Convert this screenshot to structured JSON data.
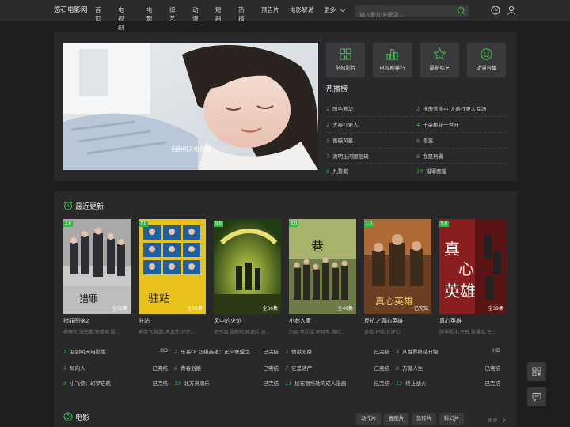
{
  "site": {
    "logo": "悠石电影网"
  },
  "nav": {
    "items": [
      "首页",
      "电视剧",
      "电影",
      "综艺",
      "动漫",
      "短剧",
      "热播",
      "预告片",
      "电影解说",
      "更多"
    ]
  },
  "search": {
    "placeholder": "输入影片关键词..."
  },
  "hero": {
    "caption": "回到明天电影版"
  },
  "quick": [
    {
      "label": "全部影片",
      "icon": "grid-icon"
    },
    {
      "label": "电视剧排行",
      "icon": "bar-chart-icon"
    },
    {
      "label": "最新综艺",
      "icon": "star-icon"
    },
    {
      "label": "动漫合集",
      "icon": "smile-icon"
    }
  ],
  "hot": {
    "title": "热播榜",
    "items": [
      {
        "num": "1",
        "name": "国色芳华"
      },
      {
        "num": "2",
        "name": "推市营业中 大奉打更人专场"
      },
      {
        "num": "3",
        "name": "大奉打更人"
      },
      {
        "num": "4",
        "name": "千朵桃花一世开"
      },
      {
        "num": "5",
        "name": "蔷薇风暴"
      },
      {
        "num": "6",
        "name": "冬至"
      },
      {
        "num": "7",
        "name": "清明上河图密码"
      },
      {
        "num": "8",
        "name": "我是刑警"
      },
      {
        "num": "9",
        "name": "九重紫"
      },
      {
        "num": "10",
        "name": "猎罪图鉴"
      }
    ]
  },
  "recent": {
    "title": "最近更新",
    "cards": [
      {
        "score": "2.6",
        "eps": "全30集",
        "title": "猎罪图鉴2",
        "cast": "檀健次,张柏嘉,朱嘉琦,陆..."
      },
      {
        "score": "7.0",
        "eps": "全33集",
        "title": "驻站",
        "cast": "郭京飞,陈数,李浩菲,孙艺..."
      },
      {
        "score": "5.0",
        "eps": "全36集",
        "title": "风中的火焰",
        "cast": "王千源,张奕明,韩采廷,吴..."
      },
      {
        "score": "6.0",
        "eps": "全40集",
        "title": "小巷人家",
        "cast": "闫妮,李光洁,郭晓东,蒋欣..."
      },
      {
        "score": "1.0",
        "eps": "已完结",
        "title": "反抗之真心英雄",
        "cast": "吴毅,任帅,许还幻"
      },
      {
        "score": "5.0",
        "eps": "全39集",
        "title": "真心英雄",
        "cast": "张丰毅,杜子名,张晨晓,许..."
      }
    ],
    "list": [
      {
        "num": "1",
        "name": "回到明天电影版",
        "status": "HD"
      },
      {
        "num": "2",
        "name": "乐高DC超级英雄：正义联盟之...",
        "status": "已完结"
      },
      {
        "num": "3",
        "name": "情欲陷阱",
        "status": "已完结"
      },
      {
        "num": "4",
        "name": "从世界终结开始",
        "status": "HD"
      },
      {
        "num": "5",
        "name": "局内人",
        "status": "已完结"
      },
      {
        "num": "6",
        "name": "青春划痕",
        "status": "已完结"
      },
      {
        "num": "7",
        "name": "它是活尸",
        "status": "已完结"
      },
      {
        "num": "8",
        "name": "方糖人生",
        "status": "已完结"
      },
      {
        "num": "9",
        "name": "小飞侠：幻梦启航",
        "status": "已完结"
      },
      {
        "num": "10",
        "name": "北方灵魂乐",
        "status": "已完结"
      },
      {
        "num": "11",
        "name": "加布丽埃勒的成人漫画",
        "status": "已完结"
      },
      {
        "num": "12",
        "name": "终止战火",
        "status": "已完结"
      }
    ]
  },
  "movies": {
    "title": "电影",
    "tags": [
      "动作片",
      "喜剧片",
      "恐怖片",
      "科幻片"
    ],
    "more": "更多"
  },
  "colors": {
    "accent": "#3bb34a",
    "bg": "#1e1e1f",
    "panel": "#29292b"
  }
}
